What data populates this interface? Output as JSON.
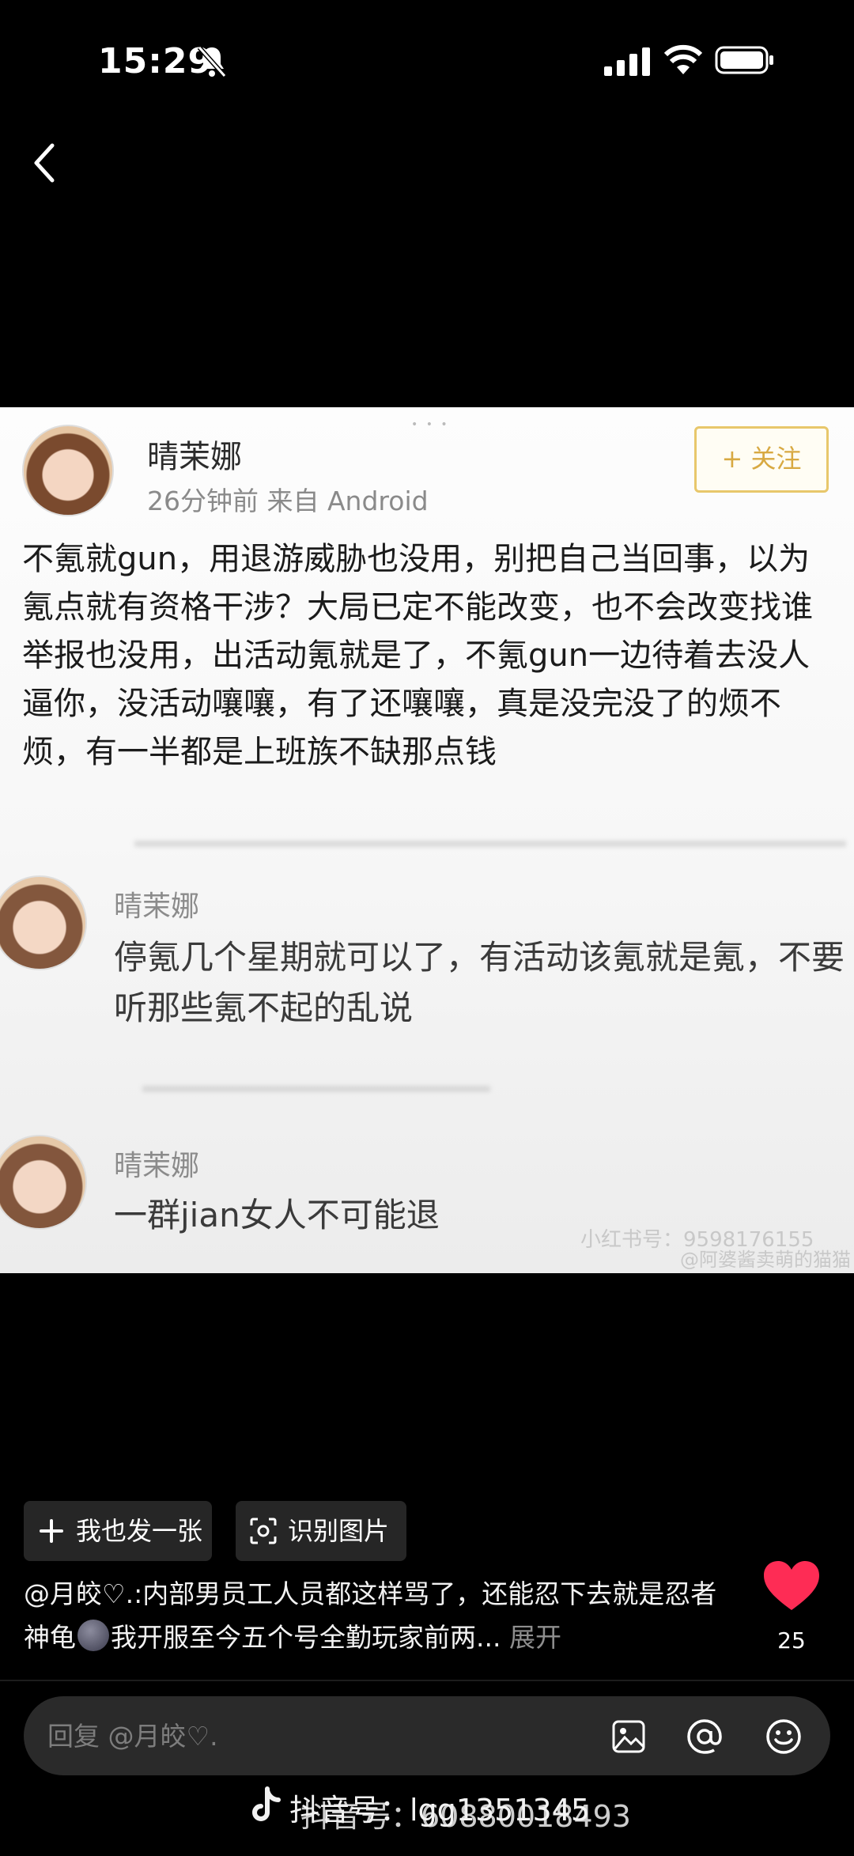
{
  "status_bar": {
    "time": "15:29",
    "icons": [
      "bell-muted-icon",
      "signal-icon",
      "wifi-icon",
      "battery-icon"
    ]
  },
  "nav": {
    "back_icon": "back-arrow-icon"
  },
  "photo": {
    "post": {
      "name": "晴茉娜",
      "meta": "26分钟前  来自 Android",
      "follow_label": "+ 关注",
      "body": "不氪就gun，用退游威胁也没用，别把自己当回事，以为氪点就有资格干涉？大局已定不能改变，也不会改变找谁举报也没用，出活动氪就是了，不氪gun一边待着去没人逼你，没活动嚷嚷，有了还嚷嚷，真是没完没了的烦不烦，有一半都是上班族不缺那点钱"
    },
    "comments": [
      {
        "name": "晴茉娜",
        "text": "停氪几个星期就可以了，有活动该氪就是氪，不要听那些氪不起的乱说"
      },
      {
        "name": "晴茉娜",
        "text": "一群jian女人不可能退"
      }
    ],
    "watermarks": [
      "小红书号：9598176155",
      "@阿婆酱卖萌的猫猫"
    ]
  },
  "actions": {
    "post_too_label": "我也发一张",
    "recognize_label": "识别图片"
  },
  "caption": {
    "part1": "@月皎♡.:内部男员工人员都这样骂了，还能忍下去就是忍者神龟",
    "part2": "我开服至今五个号全勤玩家前两...",
    "expand_label": "展开"
  },
  "like": {
    "count": "25",
    "color": "#fe2c55"
  },
  "reply": {
    "placeholder": "回复 @月皎♡.",
    "icons": [
      "image-icon",
      "at-icon",
      "emoji-icon"
    ]
  },
  "watermark": {
    "line1": "抖音号：lgg1351345",
    "line2": "抖音号：60880018493"
  }
}
